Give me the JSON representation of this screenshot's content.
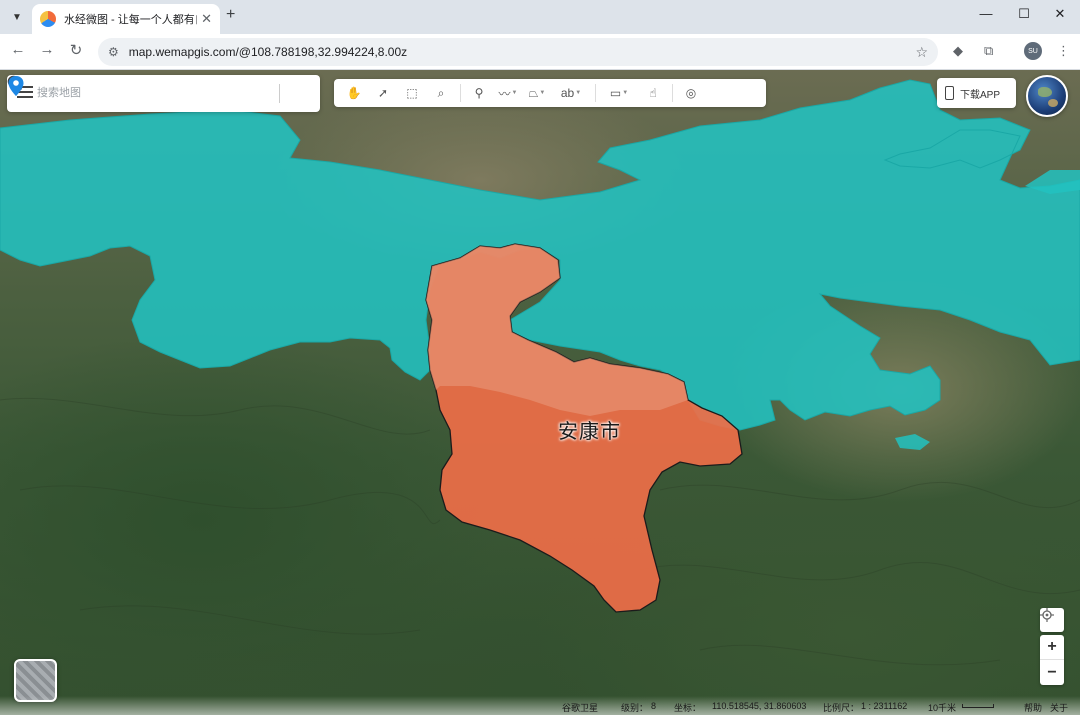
{
  "browser": {
    "tab_title": "水经微图 - 让每一个人都有自己",
    "url": "map.wemapgis.com/@108.788198,32.994224,8.00z",
    "profile_initials": "SU"
  },
  "search": {
    "placeholder": "搜索地图"
  },
  "toolbar": {
    "tools": [
      "pan-hand-icon",
      "select-arrow-icon",
      "box-select-icon",
      "zoom-search-icon",
      "marker-icon",
      "polyline-icon",
      "polygon-icon",
      "text-label-icon",
      "layer-compare-icon",
      "info-pointer-icon",
      "globe-3d-icon"
    ],
    "text_tool_label": "ab"
  },
  "download": {
    "label": "下载APP"
  },
  "map": {
    "city_label": "安康市",
    "highlight_color": "#e8704a",
    "region_color": "#22c2c0"
  },
  "status": {
    "basemap": "谷歌卫星",
    "level_label": "级别：",
    "level": "8",
    "coord_label": "坐标：",
    "coords": "110.518545, 31.860603",
    "scale_label": "比例尺：",
    "scale": "1 : 2311162",
    "scale_bar": "10千米",
    "help": "帮助",
    "about": "关于"
  }
}
